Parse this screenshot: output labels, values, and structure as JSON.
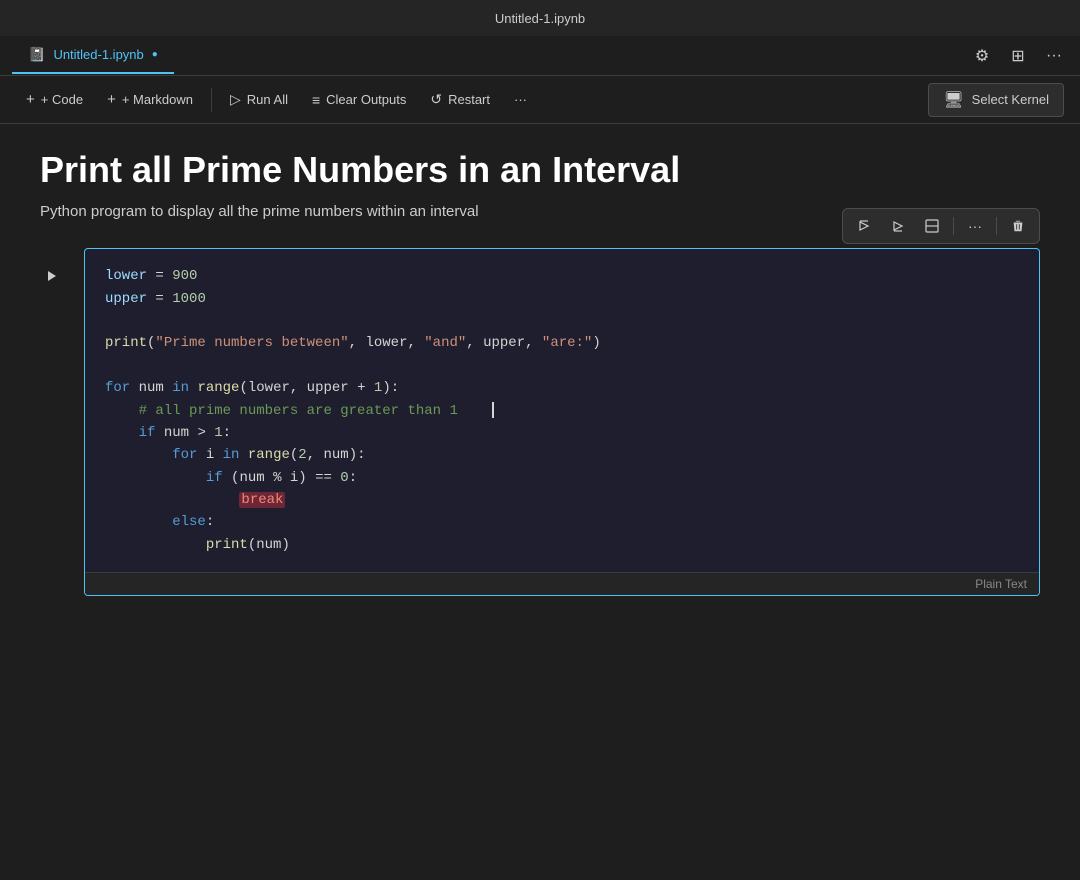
{
  "titleBar": {
    "title": "Untitled-1.ipynb"
  },
  "tabBar": {
    "activeTab": "Untitled-1.ipynb",
    "dot": "●",
    "icons": {
      "settings": "⚙",
      "layout": "⊞",
      "more": "···"
    }
  },
  "toolbar": {
    "addCode": "+ Code",
    "addMarkdown": "+ Markdown",
    "runAll": "Run All",
    "clearOutputs": "Clear Outputs",
    "restart": "Restart",
    "more": "···",
    "selectKernel": "Select Kernel"
  },
  "notebook": {
    "title": "Print all Prime Numbers in an Interval",
    "subtitle": "Python program to display all the prime numbers within an interval"
  },
  "cell": {
    "statusLabel": "Plain Text",
    "cellToolbar": {
      "runAbove": "▷↑",
      "runBelow": "▷↓",
      "splitCell": "⊟",
      "more": "···",
      "delete": "🗑"
    }
  }
}
